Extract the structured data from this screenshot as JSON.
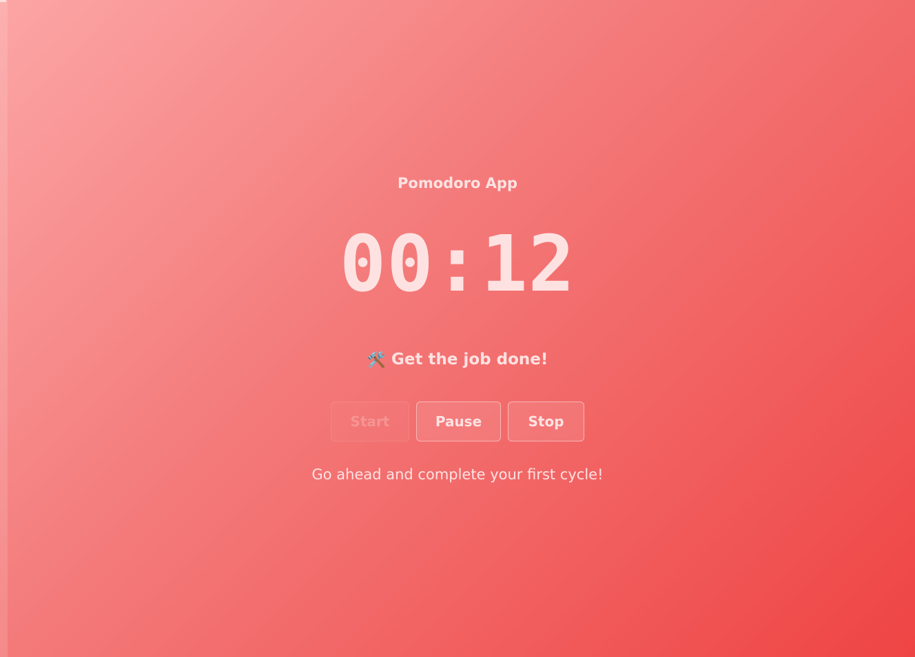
{
  "app": {
    "title": "Pomodoro App"
  },
  "timer": {
    "display": "00:12"
  },
  "motto": {
    "icon": "hammer-and-wrench-icon",
    "glyph": "🛠️",
    "text": "Get the job done!"
  },
  "controls": {
    "start_label": "Start",
    "pause_label": "Pause",
    "stop_label": "Stop"
  },
  "status": {
    "message": "Go ahead and complete your first cycle!"
  },
  "colors": {
    "gradient_start": "#fca5a5",
    "gradient_end": "#ef4444",
    "text": "#fee2e2"
  }
}
